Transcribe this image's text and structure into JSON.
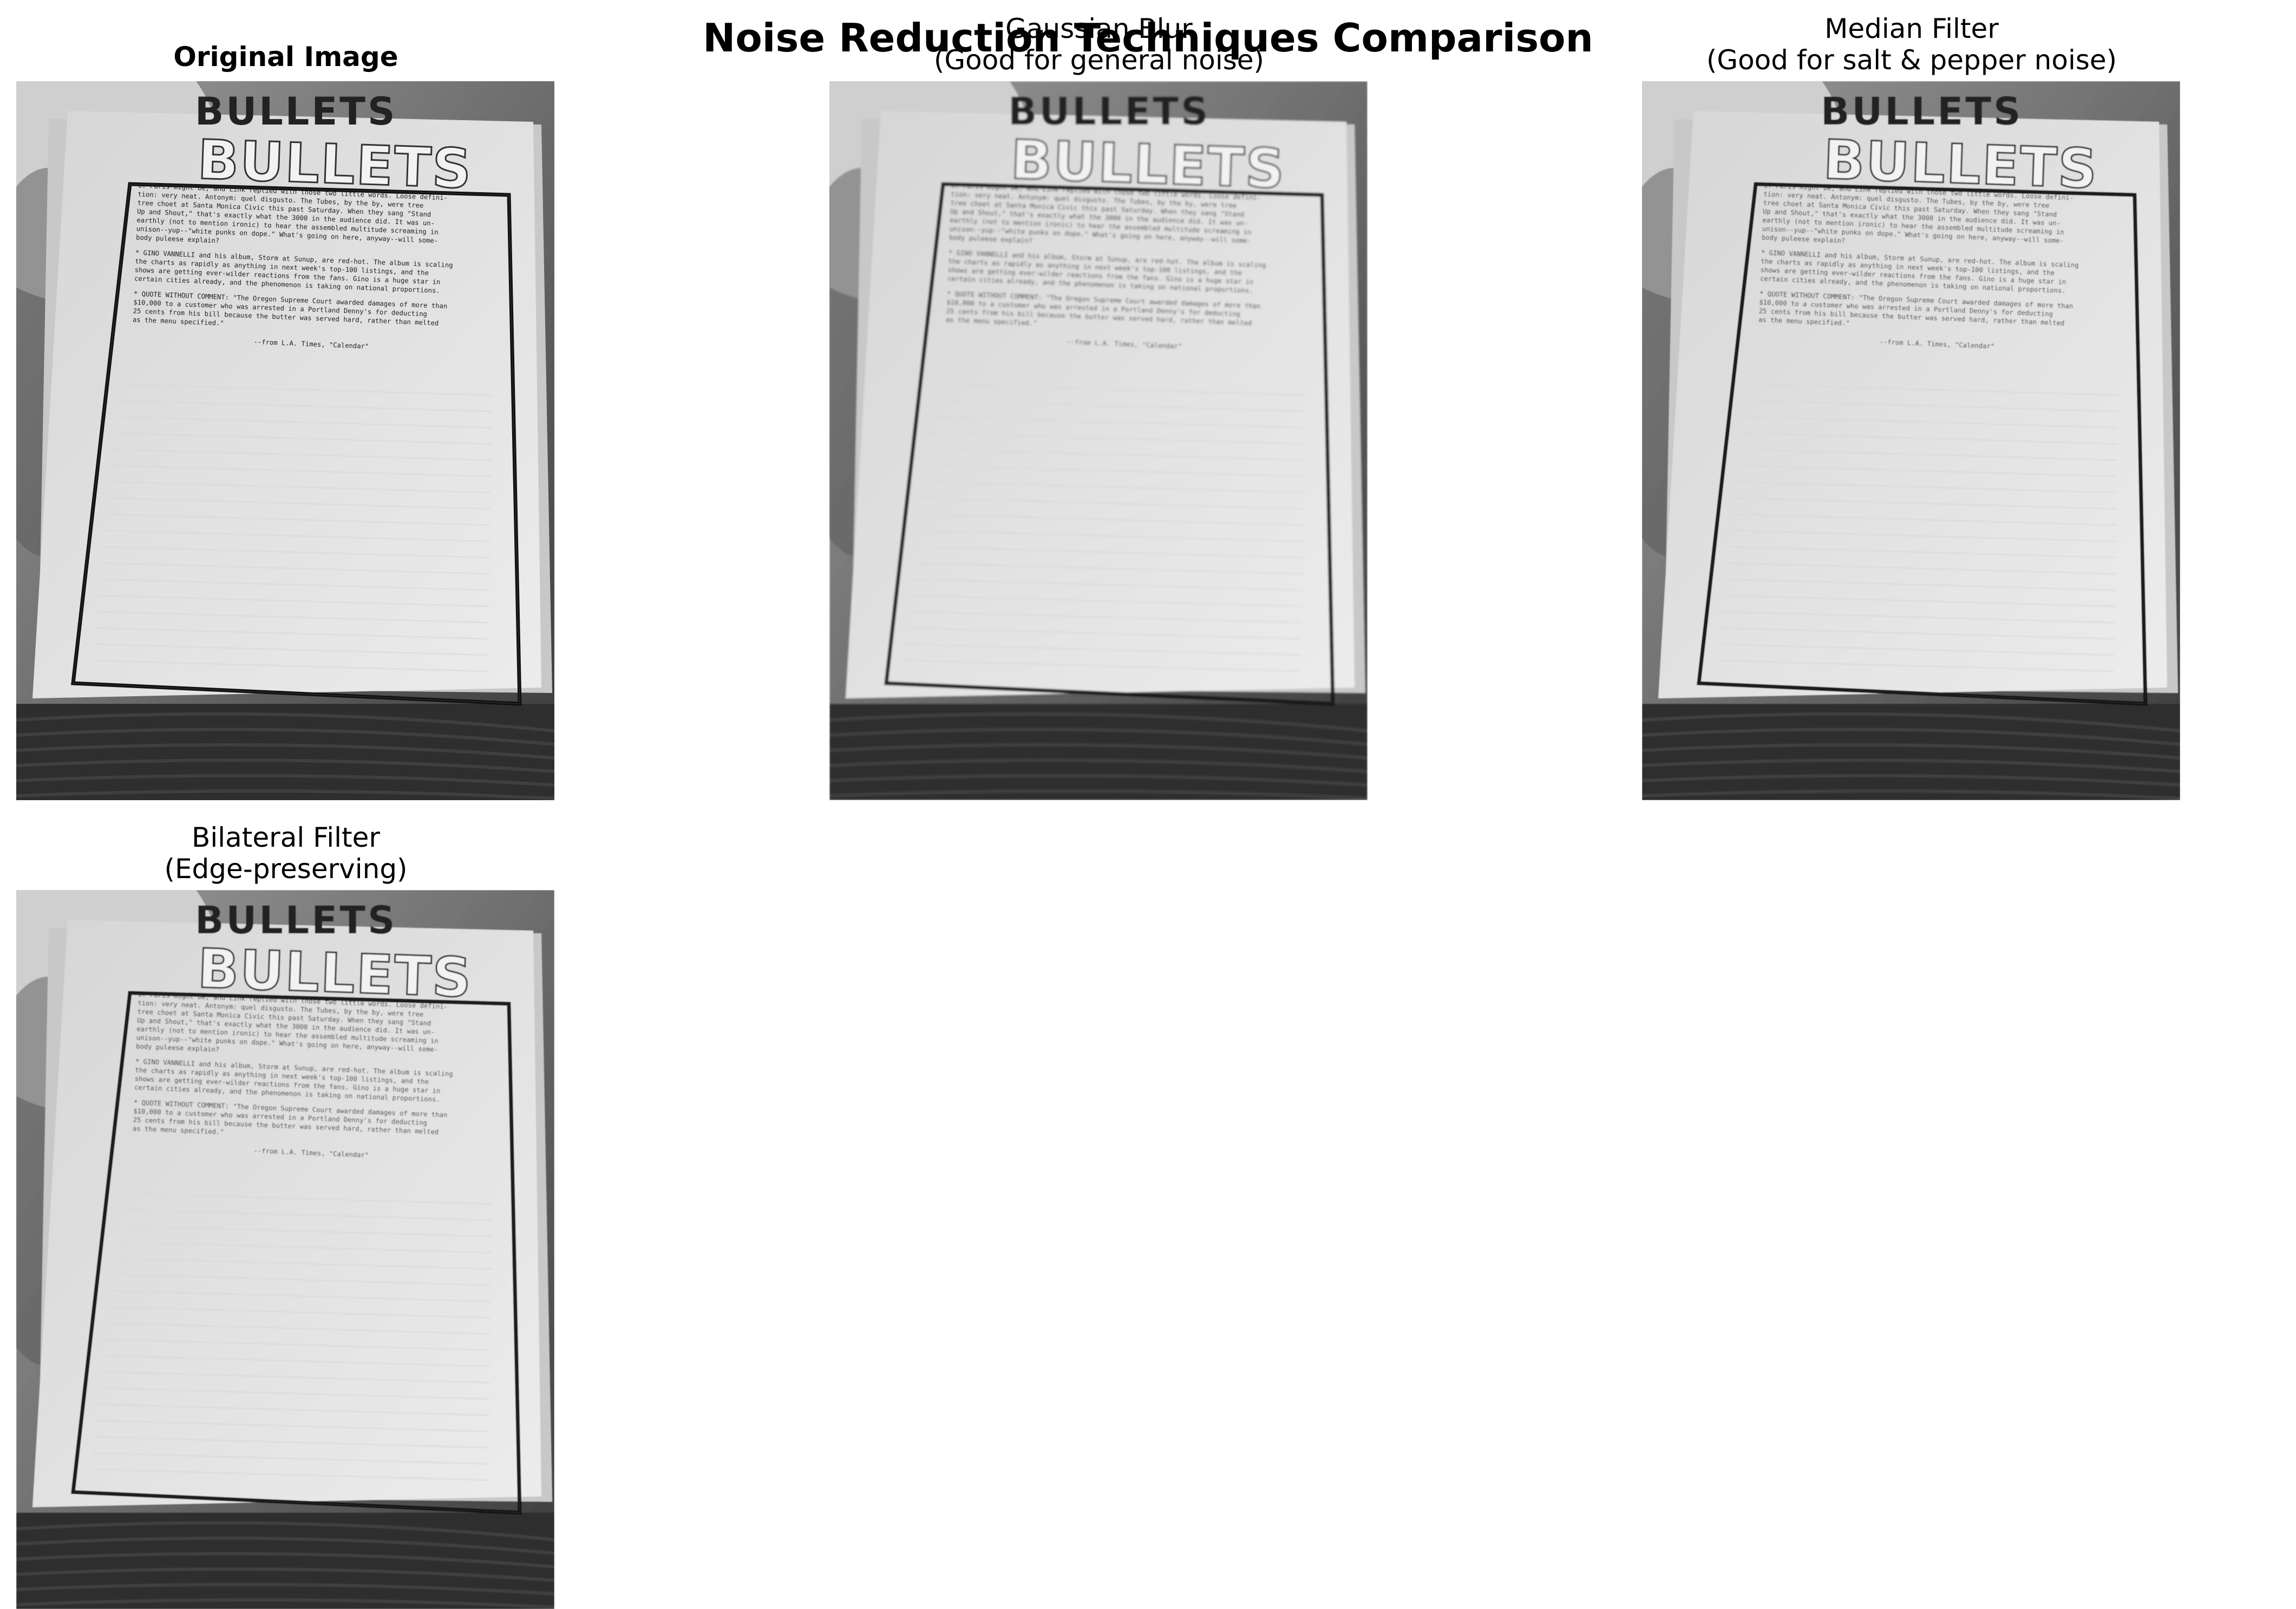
{
  "figure": {
    "title": "Noise Reduction Techniques Comparison"
  },
  "panels": [
    {
      "title": "Original Image",
      "image": {
        "heading": "BULLETS",
        "paragraphs": [
          [
            "of Paris might be, and Link replied with those two little words.  Loose defini-",
            "tion:  very neat.  Antonym:  quel disgusto.  The Tubes, by the by, were tree",
            "tree choet at Santa Monica Civic this past Saturday.  When they sang \"Stand",
            "Up and Shout,\" that's exactly what the 3000 in the audience did.  It was un-",
            "earthly (not to mention ironic) to hear the assembled multitude screaming in",
            "unison--yup--\"white punks on dope.\"  What's going on here, anyway--will some-",
            "body puleese explain?"
          ],
          [
            "* GINO VANNELLI and his album, Storm at Sunup, are red-hot.  The album is scaling",
            "the charts as rapidly as anything in next week's top-100 listings, and the",
            "shows are getting ever-wilder reactions from the fans.  Gino is a huge star in",
            "certain cities already, and the phenomenon is taking on national proportions."
          ],
          [
            "* QUOTE WITHOUT COMMENT:  \"The Oregon Supreme Court awarded damages of more than",
            "$10,000 to a customer who was arrested in a Portland Denny's for deducting",
            "25 cents from his bill because the butter was served hard, rather than melted",
            "as the menu specified.\""
          ]
        ],
        "source": "--from L.A. Times, \"Calendar\""
      }
    },
    {
      "title": "Gaussian Blur\n(Good for general noise)",
      "image": {
        "heading": "BULLETS",
        "paragraphs": [
          [
            "of Paris might be, and Link replied with those two little words.  Loose defini-",
            "tion:  very neat.  Antonym:  quel disgusto.  The Tubes, by the by, were tree",
            "tree choet at Santa Monica Civic this past Saturday.  When they sang \"Stand",
            "Up and Shout,\" that's exactly what the 3000 in the audience did.  It was un-",
            "earthly (not to mention ironic) to hear the assembled multitude screaming in",
            "unison--yup--\"white punks on dope.\"  What's going on here, anyway--will some-",
            "body puleese explain?"
          ],
          [
            "* GINO VANNELLI and his album, Storm at Sunup, are red-hot.  The album is scaling",
            "the charts as rapidly as anything in next week's top-100 listings, and the",
            "shows are getting ever-wilder reactions from the fans.  Gino is a huge star in",
            "certain cities already, and the phenomenon is taking on national proportions."
          ],
          [
            "* QUOTE WITHOUT COMMENT:  \"The Oregon Supreme Court awarded damages of more than",
            "$10,000 to a customer who was arrested in a Portland Denny's for deducting",
            "25 cents from his bill because the butter was served hard, rather than melted",
            "as the menu specified.\""
          ]
        ],
        "source": "--from L.A. Times, \"Calendar\""
      }
    },
    {
      "title": "Median Filter\n(Good for salt & pepper noise)",
      "image": {
        "heading": "BULLETS",
        "paragraphs": [
          [
            "of Paris might be, and Link replied with those two little words.  Loose defini-",
            "tion:  very neat.  Antonym:  quel disgusto.  The Tubes, by the by, were tree",
            "tree choet at Santa Monica Civic this past Saturday.  When they sang \"Stand",
            "Up and Shout,\" that's exactly what the 3000 in the audience did.  It was un-",
            "earthly (not to mention ironic) to hear the assembled multitude screaming in",
            "unison--yup--\"white punks on dope.\"  What's going on here, anyway--will some-",
            "body puleese explain?"
          ],
          [
            "* GINO VANNELLI and his album, Storm at Sunup, are red-hot.  The album is scaling",
            "the charts as rapidly as anything in next week's top-100 listings, and the",
            "shows are getting ever-wilder reactions from the fans.  Gino is a huge star in",
            "certain cities already, and the phenomenon is taking on national proportions."
          ],
          [
            "* QUOTE WITHOUT COMMENT:  \"The Oregon Supreme Court awarded damages of more than",
            "$10,000 to a customer who was arrested in a Portland Denny's for deducting",
            "25 cents from his bill because the butter was served hard, rather than melted",
            "as the menu specified.\""
          ]
        ],
        "source": "--from L.A. Times, \"Calendar\""
      }
    },
    {
      "title": "Bilateral Filter\n(Edge-preserving)",
      "image": {
        "heading": "BULLETS",
        "paragraphs": [
          [
            "of Paris might be, and Link replied with those two little words.  Loose defini-",
            "tion:  very neat.  Antonym:  quel disgusto.  The Tubes, by the by, were tree",
            "tree choet at Santa Monica Civic this past Saturday.  When they sang \"Stand",
            "Up and Shout,\" that's exactly what the 3000 in the audience did.  It was un-",
            "earthly (not to mention ironic) to hear the assembled multitude screaming in",
            "unison--yup--\"white punks on dope.\"  What's going on here, anyway--will some-",
            "body puleese explain?"
          ],
          [
            "* GINO VANNELLI and his album, Storm at Sunup, are red-hot.  The album is scaling",
            "the charts as rapidly as anything in next week's top-100 listings, and the",
            "shows are getting ever-wilder reactions from the fans.  Gino is a huge star in",
            "certain cities already, and the phenomenon is taking on national proportions."
          ],
          [
            "* QUOTE WITHOUT COMMENT:  \"The Oregon Supreme Court awarded damages of more than",
            "$10,000 to a customer who was arrested in a Portland Denny's for deducting",
            "25 cents from his bill because the butter was served hard, rather than melted",
            "as the menu specified.\""
          ]
        ],
        "source": "--from L.A. Times, \"Calendar\""
      }
    }
  ]
}
